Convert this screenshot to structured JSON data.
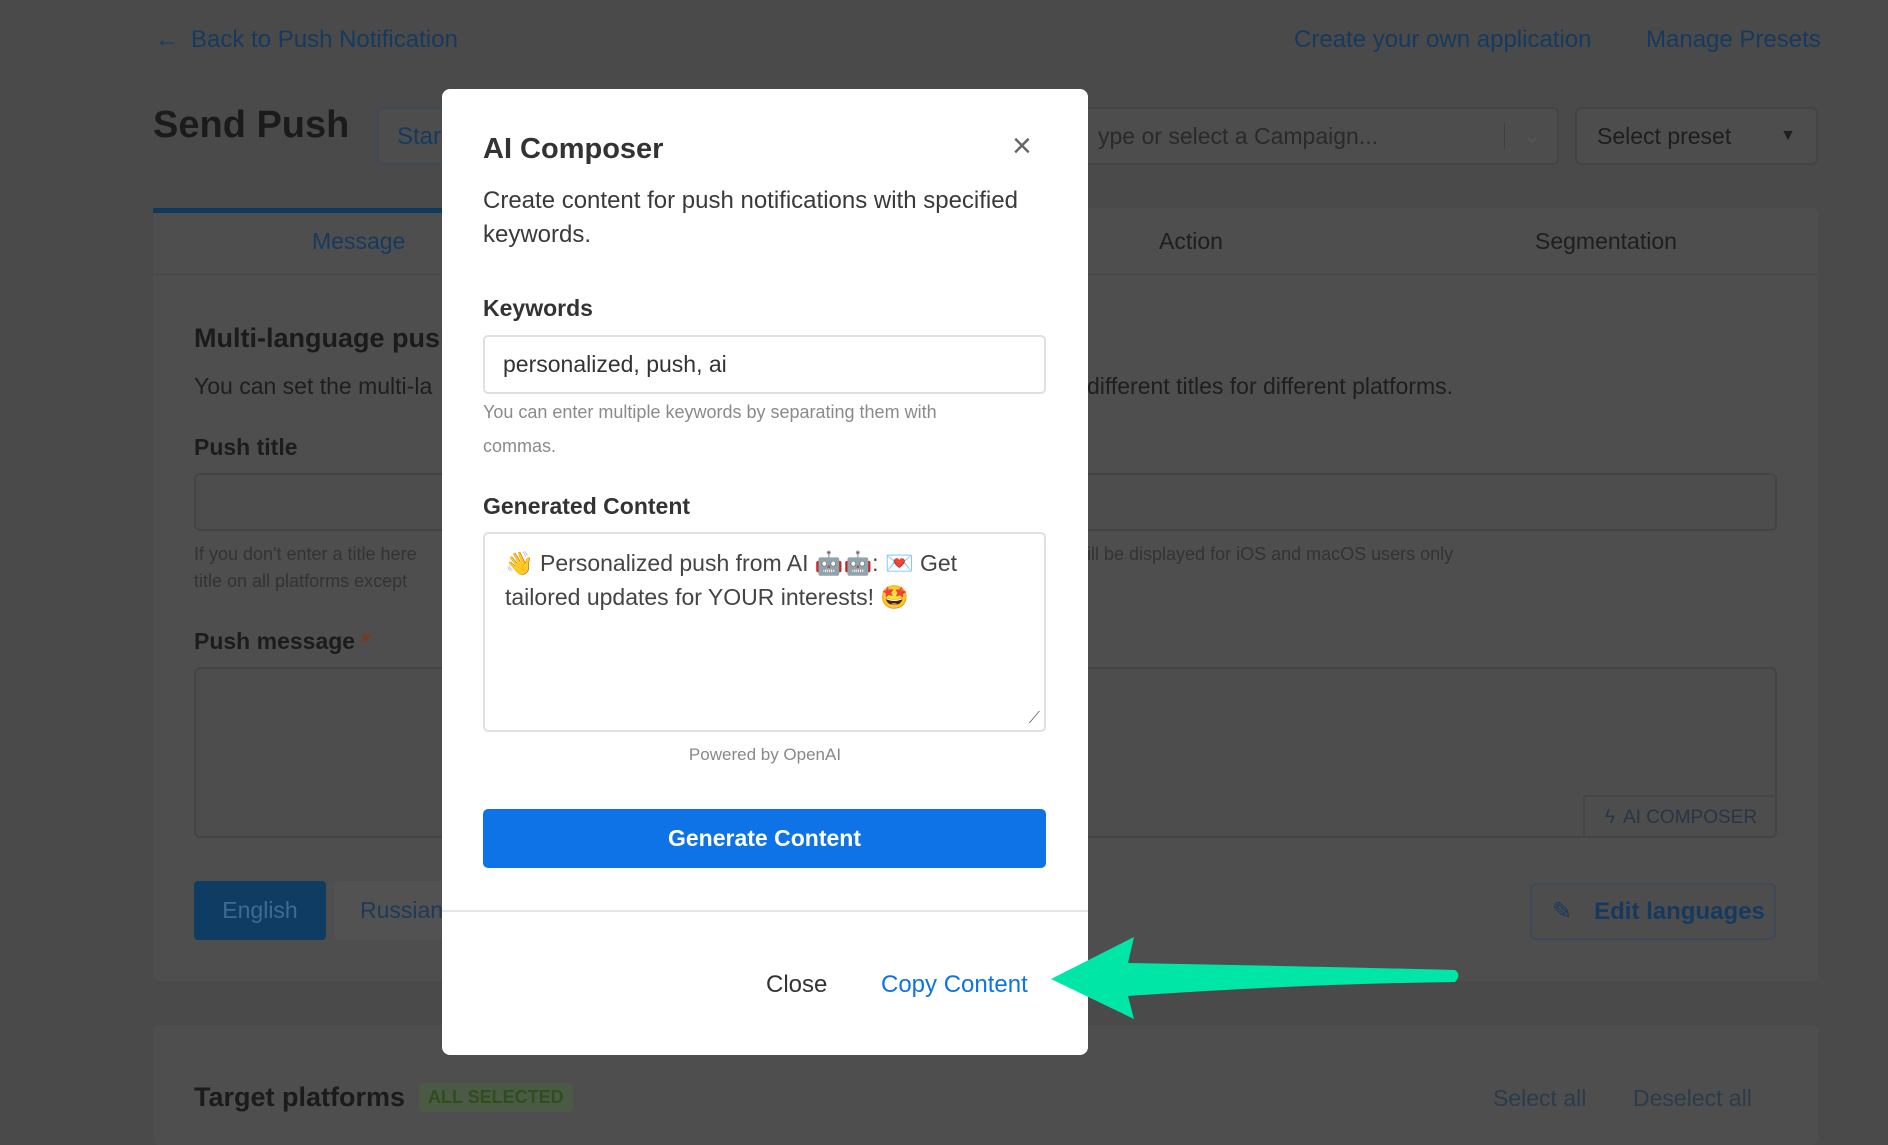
{
  "header": {
    "back_link": "Back to Push Notification",
    "create_app_link": "Create your own application",
    "manage_presets_link": "Manage Presets"
  },
  "page": {
    "title": "Send Push",
    "start_button": "Star",
    "campaign_placeholder": "ype or select a Campaign...",
    "preset_select": "Select preset"
  },
  "tabs": [
    {
      "label": "Message",
      "active": true
    },
    {
      "label": "Action"
    },
    {
      "label": "Segmentation"
    }
  ],
  "message": {
    "section_title": "Multi-language pusl",
    "section_desc_left": "You can set the multi-la",
    "section_desc_right": "different titles for different platforms.",
    "push_title_label": "Push title",
    "title_hint_left_1": "If you don't enter a title here",
    "title_hint_left_2": "title on all platforms except",
    "title_hint_right": "ill be displayed for iOS and macOS users only",
    "push_message_label": "Push message",
    "required_mark": "*",
    "ai_composer_button": "AI COMPOSER",
    "languages": [
      "English",
      "Russian"
    ],
    "edit_languages_button": "Edit languages"
  },
  "platforms": {
    "title": "Target platforms",
    "badge": "ALL SELECTED",
    "select_all": "Select all",
    "deselect_all": "Deselect all"
  },
  "modal": {
    "title": "AI Composer",
    "description_1": "Create content for push notifications with specified",
    "description_2": "keywords.",
    "keywords_label": "Keywords",
    "keywords_value": "personalized, push, ai",
    "keywords_hint_1": "You can enter multiple keywords by separating them with",
    "keywords_hint_2": "commas.",
    "generated_label": "Generated Content",
    "generated_line_1": "👋 Personalized push from AI 🤖🤖: 💌 Get",
    "generated_line_2": "tailored updates for YOUR interests! 🤩",
    "powered_by": "Powered by OpenAI",
    "generate_button": "Generate Content",
    "close_button": "Close",
    "copy_button": "Copy Content"
  },
  "colors": {
    "accent": "#0e73e6",
    "annotation_arrow": "#00e6a6",
    "overlay": "#4a4a4a"
  }
}
